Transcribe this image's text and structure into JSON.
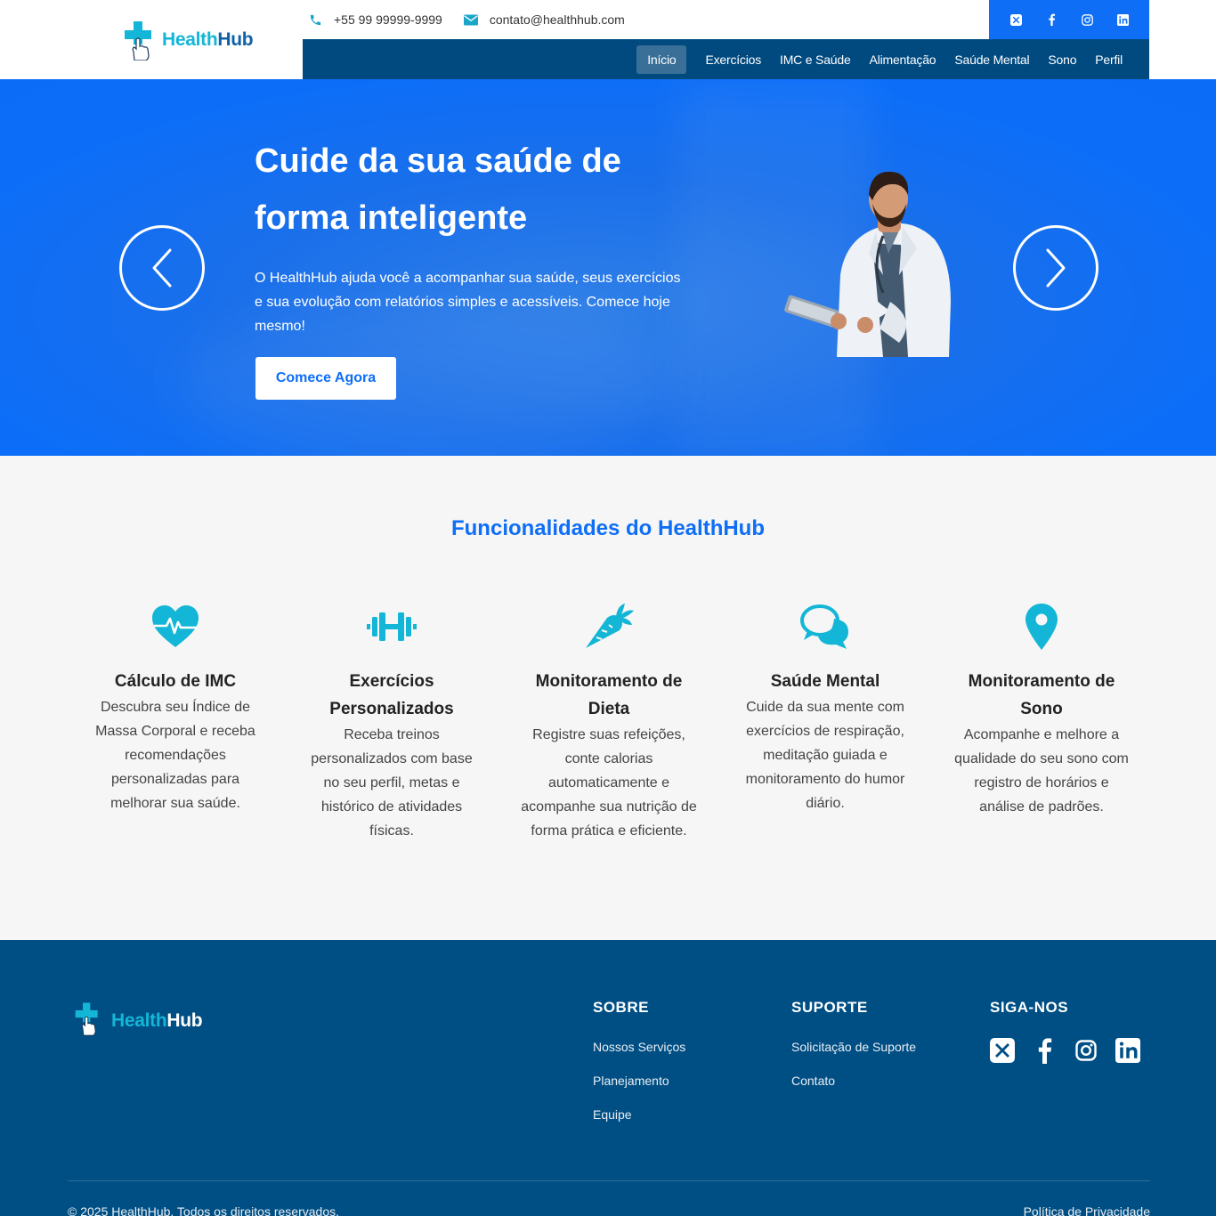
{
  "brand": {
    "part1": "Health",
    "part2": "Hub"
  },
  "contact": {
    "phone": "+55 99 99999-9999",
    "email": "contato@healthhub.com"
  },
  "social": [
    "x-icon",
    "facebook-icon",
    "instagram-icon",
    "linkedin-icon"
  ],
  "nav": {
    "items": [
      "Início",
      "Exercícios",
      "IMC e Saúde",
      "Alimentação",
      "Saúde Mental",
      "Sono",
      "Perfil"
    ],
    "active": "Início"
  },
  "hero": {
    "title": "Cuide da sua saúde de forma inteligente",
    "text": "O HealthHub ajuda você a acompanhar sua saúde, seus exercícios e sua evolução com relatórios simples e acessíveis. Comece hoje mesmo!",
    "cta": "Comece Agora"
  },
  "features": {
    "title": "Funcionalidades do HealthHub",
    "items": [
      {
        "title": "Cálculo de IMC",
        "desc": "Descubra seu Índice de Massa Corporal e receba recomendações personalizadas para melhorar sua saúde.",
        "icon": "heartbeat-icon"
      },
      {
        "title": "Exercícios Personalizados",
        "desc": "Receba treinos personalizados com base no seu perfil, metas e histórico de atividades físicas.",
        "icon": "dumbbell-icon"
      },
      {
        "title": "Monitoramento de Dieta",
        "desc": "Registre suas refeições, conte calorias automaticamente e acompanhe sua nutrição de forma prática e eficiente.",
        "icon": "carrot-icon"
      },
      {
        "title": "Saúde Mental",
        "desc": "Cuide da sua mente com exercícios de respiração, meditação guiada e monitoramento do humor diário.",
        "icon": "chat-icon"
      },
      {
        "title": "Monitoramento de Sono",
        "desc": "Acompanhe e melhore a qualidade do seu sono com registro de horários e análise de padrões.",
        "icon": "location-pin-icon"
      }
    ]
  },
  "footer": {
    "sobre": {
      "title": "SOBRE",
      "links": [
        "Nossos Serviços",
        "Planejamento",
        "Equipe"
      ]
    },
    "suporte": {
      "title": "SUPORTE",
      "links": [
        "Solicitação de Suporte",
        "Contato"
      ]
    },
    "siga": {
      "title": "SIGA-NOS"
    },
    "copyright": "© 2025 HealthHub. Todos os direitos reservados.",
    "privacy": "Política de Privacidade"
  },
  "colors": {
    "primary": "#0e6ef6",
    "navy": "#004a80",
    "footer": "#004f84",
    "accent": "#13b6d6"
  }
}
